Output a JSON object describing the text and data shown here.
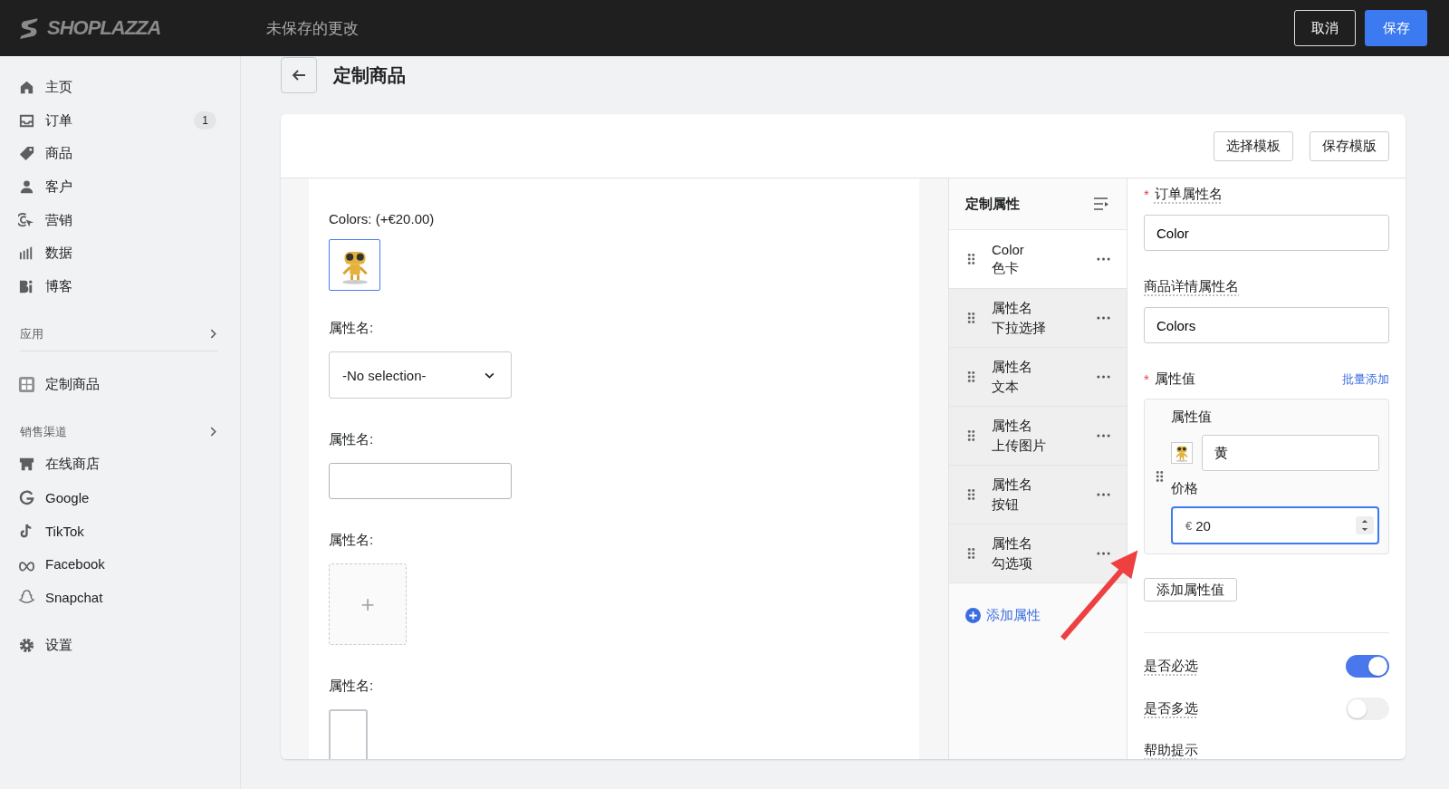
{
  "topbar": {
    "logo": "SHOPLAZZA",
    "title": "未保存的更改",
    "buttons": [
      {
        "label": "取消",
        "kind": "secondary"
      },
      {
        "label": "保存",
        "kind": "primary"
      }
    ]
  },
  "sidebar": {
    "groups": [
      {
        "items": [
          {
            "label": "主页"
          },
          {
            "label": "订单",
            "badge": "1"
          },
          {
            "label": "商品"
          },
          {
            "label": "客户"
          },
          {
            "label": "营销"
          },
          {
            "label": "数据"
          },
          {
            "label": "博客"
          }
        ]
      },
      {
        "heading": "应用",
        "items": [
          {
            "label": "定制商品"
          }
        ]
      },
      {
        "heading": "销售渠道",
        "items": [
          {
            "label": "在线商店"
          },
          {
            "label": "Google"
          },
          {
            "label": "TikTok"
          },
          {
            "label": "Facebook"
          },
          {
            "label": "Snapchat"
          }
        ]
      },
      {
        "items": [
          {
            "label": "设置"
          }
        ]
      }
    ]
  },
  "page": {
    "title": "定制商品",
    "toolbar": [
      "选择模板",
      "保存模版"
    ]
  },
  "preview": {
    "fields": [
      {
        "kind": "swatch",
        "label": "Colors:  (+€20.00)"
      },
      {
        "kind": "select",
        "label": "属性名:",
        "value": "-No selection-"
      },
      {
        "kind": "text",
        "label": "属性名:"
      },
      {
        "kind": "upload",
        "label": "属性名:",
        "glyph": "+"
      },
      {
        "kind": "button",
        "label": "属性名:"
      }
    ]
  },
  "attributes": {
    "title": "定制属性",
    "items": [
      {
        "name": "Color",
        "type": "色卡",
        "selected": true
      },
      {
        "name": "属性名",
        "type": "下拉选择",
        "selected": false
      },
      {
        "name": "属性名",
        "type": "文本",
        "selected": false
      },
      {
        "name": "属性名",
        "type": "上传图片",
        "selected": false
      },
      {
        "name": "属性名",
        "type": "按钮",
        "selected": false
      },
      {
        "name": "属性名",
        "type": "勾选项",
        "selected": false
      }
    ],
    "add": "添加属性"
  },
  "settings": {
    "fields": [
      {
        "label": "订单属性名",
        "required_mark": "*",
        "value": "Color"
      },
      {
        "label": "商品详情属性名",
        "value": "Colors"
      }
    ],
    "values": {
      "label": "属性值",
      "required_mark": "*",
      "link": "批量添加",
      "card": {
        "label": "属性值",
        "value": "黄",
        "price_label": "价格",
        "currency": "€",
        "price": "20"
      },
      "add": "添加属性值"
    },
    "toggles": [
      {
        "label": "是否必选",
        "on": true
      },
      {
        "label": "是否多选",
        "on": false
      }
    ],
    "help_label": "帮助提示"
  }
}
